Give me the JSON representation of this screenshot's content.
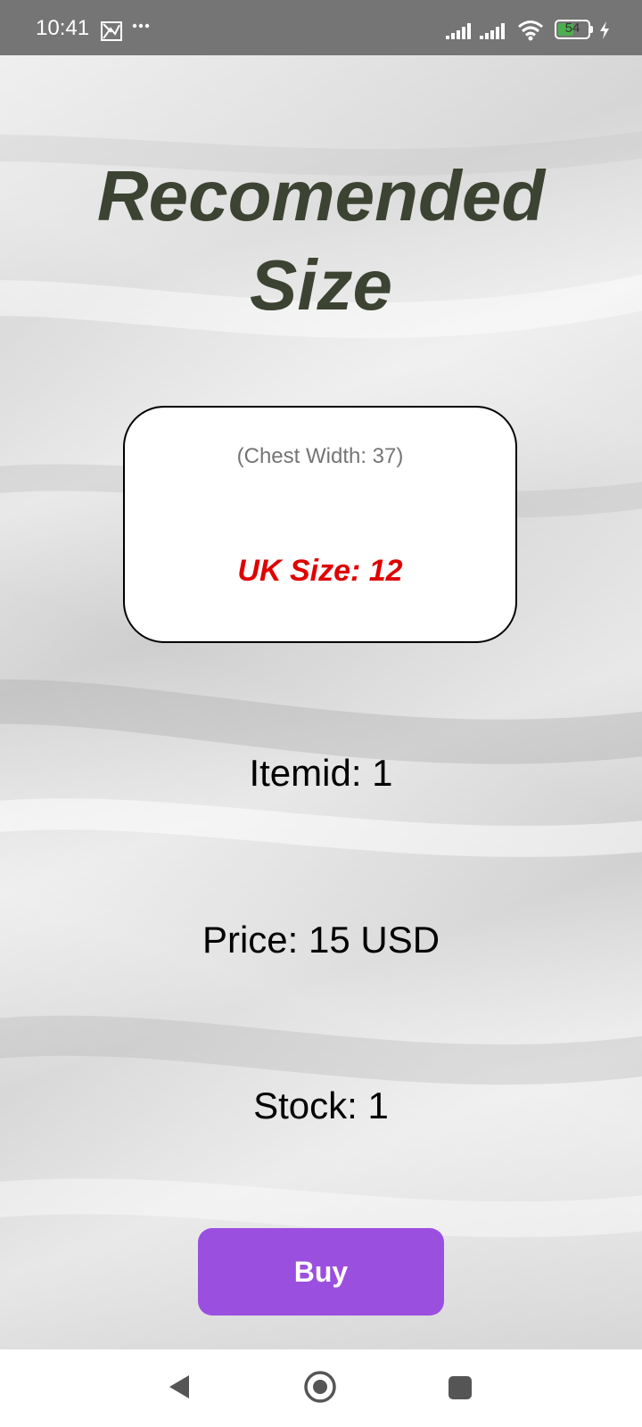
{
  "status_bar": {
    "time": "10:41",
    "battery_level": "54",
    "icons": [
      "notification-icon",
      "more-dots-icon",
      "signal-icon",
      "signal-icon",
      "wifi-icon",
      "battery-icon",
      "charging-icon"
    ]
  },
  "main": {
    "title_line1": "Recomended",
    "title_line2": "Size",
    "card": {
      "chest_width": "(Chest Width: 37)",
      "uk_size": "UK Size: 12"
    },
    "item_id": "Itemid: 1",
    "price": "Price: 15 USD",
    "stock": "Stock: 1",
    "buy_label": "Buy"
  },
  "nav_bar": {
    "icons": [
      "back-icon",
      "home-icon",
      "recents-icon"
    ]
  },
  "colors": {
    "title": "#3c4332",
    "uk_size": "#e00000",
    "button": "#9b4fdf",
    "status_bar": "#757575",
    "battery_fill": "#4caf50"
  }
}
